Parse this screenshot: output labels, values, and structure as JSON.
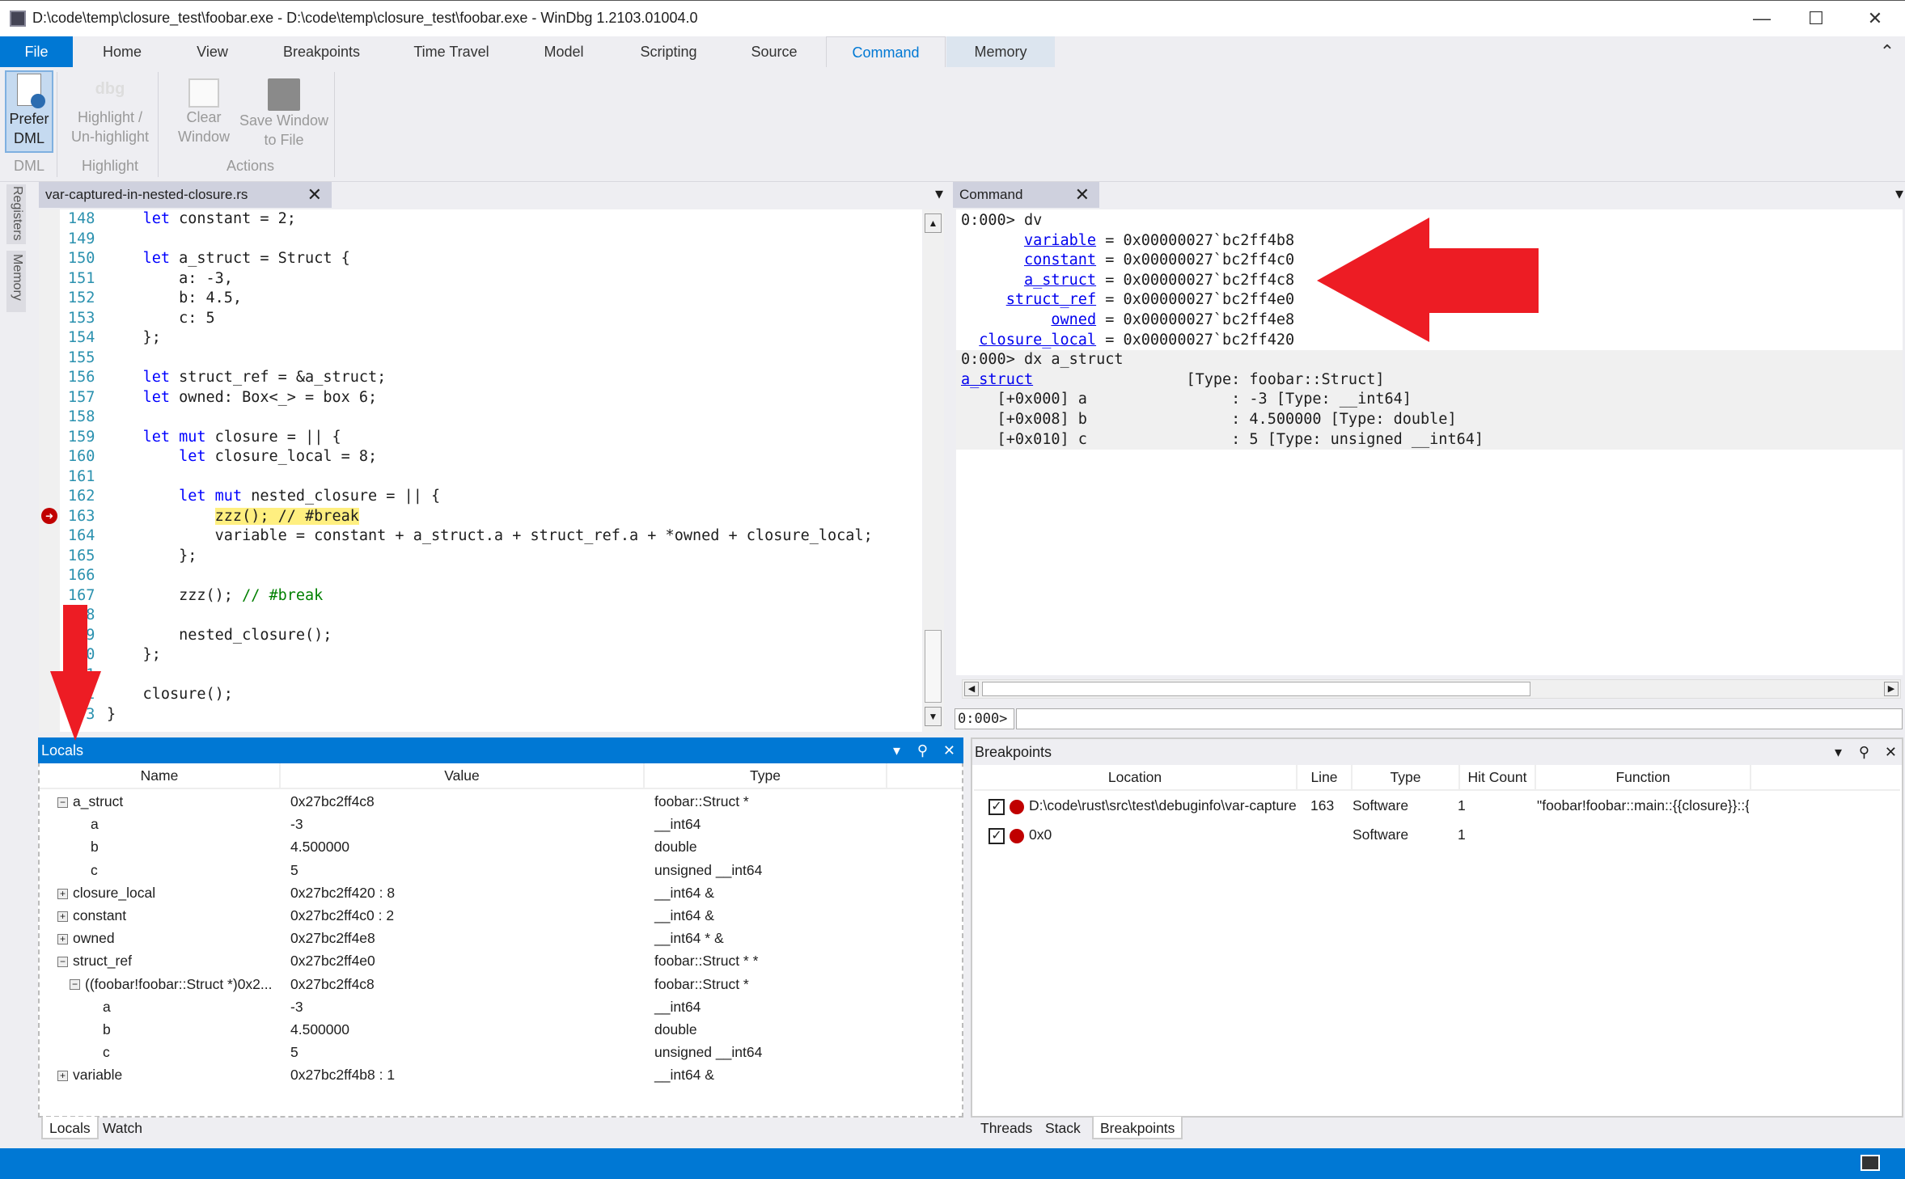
{
  "window": {
    "title": "D:\\code\\temp\\closure_test\\foobar.exe - D:\\code\\temp\\closure_test\\foobar.exe  - WinDbg 1.2103.01004.0",
    "minimize": "—",
    "maximize": "☐",
    "close": "✕"
  },
  "ribbon": {
    "file": "File",
    "tabs": [
      "Home",
      "View",
      "Breakpoints",
      "Time Travel",
      "Model",
      "Scripting",
      "Source",
      "Command",
      "Memory"
    ],
    "active_tab": "Command",
    "collapse": "⌃",
    "buttons": {
      "prefer_dml": [
        "Prefer",
        "DML"
      ],
      "highlight": [
        "Highlight /",
        "Un-highlight"
      ],
      "clear": [
        "Clear",
        "Window"
      ],
      "save": [
        "Save Window",
        "to File"
      ],
      "dbg_icon": "dbg"
    },
    "groups": [
      "DML",
      "Highlight",
      "Actions"
    ]
  },
  "side_tabs": [
    "Registers",
    "Memory"
  ],
  "source": {
    "tab": "var-captured-in-nested-closure.rs",
    "close": "✕",
    "menu": "▾",
    "current_line": 163,
    "lines": [
      {
        "n": "148",
        "t": [
          [
            "    ",
            ""
          ],
          [
            "let",
            "kw"
          ],
          [
            " constant = 2;",
            ""
          ]
        ]
      },
      {
        "n": "149",
        "t": []
      },
      {
        "n": "150",
        "t": [
          [
            "    ",
            ""
          ],
          [
            "let",
            "kw"
          ],
          [
            " a_struct = Struct {",
            ""
          ]
        ]
      },
      {
        "n": "151",
        "t": [
          [
            "        a: -3,",
            ""
          ]
        ]
      },
      {
        "n": "152",
        "t": [
          [
            "        b: 4.5,",
            ""
          ]
        ]
      },
      {
        "n": "153",
        "t": [
          [
            "        c: 5",
            ""
          ]
        ]
      },
      {
        "n": "154",
        "t": [
          [
            "    };",
            ""
          ]
        ]
      },
      {
        "n": "155",
        "t": []
      },
      {
        "n": "156",
        "t": [
          [
            "    ",
            ""
          ],
          [
            "let",
            "kw"
          ],
          [
            " struct_ref = &a_struct;",
            ""
          ]
        ]
      },
      {
        "n": "157",
        "t": [
          [
            "    ",
            ""
          ],
          [
            "let",
            "kw"
          ],
          [
            " owned: Box<_> = box 6;",
            ""
          ]
        ]
      },
      {
        "n": "158",
        "t": []
      },
      {
        "n": "159",
        "t": [
          [
            "    ",
            ""
          ],
          [
            "let",
            "kw"
          ],
          [
            " ",
            ""
          ],
          [
            "mut",
            "kw"
          ],
          [
            " closure = || {",
            ""
          ]
        ]
      },
      {
        "n": "160",
        "t": [
          [
            "        ",
            ""
          ],
          [
            "let",
            "kw"
          ],
          [
            " closure_local = 8;",
            ""
          ]
        ]
      },
      {
        "n": "161",
        "t": []
      },
      {
        "n": "162",
        "t": [
          [
            "        ",
            ""
          ],
          [
            "let",
            "kw"
          ],
          [
            " ",
            ""
          ],
          [
            "mut",
            "kw"
          ],
          [
            " nested_closure = || {",
            ""
          ]
        ]
      },
      {
        "n": "163",
        "t": [
          [
            "            ",
            ""
          ],
          [
            "zzz(); // #break",
            "hl"
          ]
        ]
      },
      {
        "n": "164",
        "t": [
          [
            "            variable = constant + a_struct.a + struct_ref.a + *owned + closure_local;",
            ""
          ]
        ]
      },
      {
        "n": "165",
        "t": [
          [
            "        };",
            ""
          ]
        ]
      },
      {
        "n": "166",
        "t": []
      },
      {
        "n": "167",
        "t": [
          [
            "        zzz(); ",
            ""
          ],
          [
            "// #break",
            "cm"
          ]
        ]
      },
      {
        "n": "168",
        "t": []
      },
      {
        "n": "169",
        "t": [
          [
            "        nested_closure();",
            ""
          ]
        ]
      },
      {
        "n": "170",
        "t": [
          [
            "    };",
            ""
          ]
        ]
      },
      {
        "n": "171",
        "t": []
      },
      {
        "n": "172",
        "t": [
          [
            "    closure();",
            ""
          ]
        ]
      },
      {
        "n": "173",
        "t": [
          [
            "}",
            ""
          ]
        ]
      }
    ]
  },
  "command": {
    "tab": "Command",
    "close": "✕",
    "menu": "▾",
    "prompt": "0:000>",
    "lines": [
      {
        "t": [
          [
            "0:000> dv",
            ""
          ]
        ]
      },
      {
        "t": [
          [
            "       ",
            ""
          ],
          [
            "variable",
            "lnk"
          ],
          [
            " = 0x00000027`bc2ff4b8",
            ""
          ]
        ]
      },
      {
        "t": [
          [
            "       ",
            ""
          ],
          [
            "constant",
            "lnk"
          ],
          [
            " = 0x00000027`bc2ff4c0",
            ""
          ]
        ]
      },
      {
        "t": [
          [
            "       ",
            ""
          ],
          [
            "a_struct",
            "lnk"
          ],
          [
            " = 0x00000027`bc2ff4c8",
            ""
          ]
        ]
      },
      {
        "t": [
          [
            "     ",
            ""
          ],
          [
            "struct_ref",
            "lnk"
          ],
          [
            " = 0x00000027`bc2ff4e0",
            ""
          ]
        ]
      },
      {
        "t": [
          [
            "          ",
            ""
          ],
          [
            "owned",
            "lnk"
          ],
          [
            " = 0x00000027`bc2ff4e8",
            ""
          ]
        ]
      },
      {
        "t": [
          [
            "  ",
            ""
          ],
          [
            "closure_local",
            "lnk"
          ],
          [
            " = 0x00000027`bc2ff420",
            ""
          ]
        ]
      },
      {
        "t": [
          [
            "0:000> dx a_struct",
            ""
          ]
        ],
        "bg": true
      },
      {
        "t": [
          [
            "a_struct",
            "lnk"
          ],
          [
            "                 [Type: foobar::Struct]",
            ""
          ]
        ],
        "bg": true
      },
      {
        "t": [
          [
            "    [+0x000] a                : -3 [Type: __int64]",
            ""
          ]
        ],
        "bg": true
      },
      {
        "t": [
          [
            "    [+0x008] b                : 4.500000 [Type: double]",
            ""
          ]
        ],
        "bg": true
      },
      {
        "t": [
          [
            "    [+0x010] c                : 5 [Type: unsigned __int64]",
            ""
          ]
        ],
        "bg": true
      }
    ]
  },
  "locals": {
    "title": "Locals",
    "columns": [
      "Name",
      "Value",
      "Type"
    ],
    "rows": [
      {
        "name": "a_struct",
        "value": "0x27bc2ff4c8",
        "type": "foobar::Struct *",
        "exp": "−",
        "lvl": 0
      },
      {
        "name": "a",
        "value": "-3",
        "type": "__int64",
        "exp": "",
        "lvl": 1
      },
      {
        "name": "b",
        "value": "4.500000",
        "type": "double",
        "exp": "",
        "lvl": 1
      },
      {
        "name": "c",
        "value": "5",
        "type": "unsigned __int64",
        "exp": "",
        "lvl": 1
      },
      {
        "name": "closure_local",
        "value": "0x27bc2ff420 : 8",
        "type": "__int64 &",
        "exp": "+",
        "lvl": 0
      },
      {
        "name": "constant",
        "value": "0x27bc2ff4c0 : 2",
        "type": "__int64 &",
        "exp": "+",
        "lvl": 0
      },
      {
        "name": "owned",
        "value": "0x27bc2ff4e8",
        "type": "__int64 * &",
        "exp": "+",
        "lvl": 0
      },
      {
        "name": "struct_ref",
        "value": "0x27bc2ff4e0",
        "type": "foobar::Struct * *",
        "exp": "−",
        "lvl": 0
      },
      {
        "name": "((foobar!foobar::Struct *)0x2...",
        "value": "0x27bc2ff4c8",
        "type": "foobar::Struct *",
        "exp": "−",
        "lvl": 1
      },
      {
        "name": "a",
        "value": "-3",
        "type": "__int64",
        "exp": "",
        "lvl": 2
      },
      {
        "name": "b",
        "value": "4.500000",
        "type": "double",
        "exp": "",
        "lvl": 2
      },
      {
        "name": "c",
        "value": "5",
        "type": "unsigned __int64",
        "exp": "",
        "lvl": 2
      },
      {
        "name": "variable",
        "value": "0x27bc2ff4b8 : 1",
        "type": "__int64 &",
        "exp": "+",
        "lvl": 0
      }
    ],
    "bottom_tabs": [
      "Locals",
      "Watch"
    ]
  },
  "breakpoints": {
    "title": "Breakpoints",
    "columns": [
      "Location",
      "Line",
      "Type",
      "Hit Count",
      "Function"
    ],
    "rows": [
      {
        "enabled": true,
        "location": "D:\\code\\rust\\src\\test\\debuginfo\\var-captured-in-nested-closure.rs",
        "line": "163",
        "type": "Software",
        "hits": "1",
        "function": "\"foobar!foobar::main::{{closure}}::{{closure}}\""
      },
      {
        "enabled": true,
        "location": "0x0",
        "line": "",
        "type": "Software",
        "hits": "1",
        "function": ""
      }
    ],
    "bottom_tabs": [
      "Threads",
      "Stack",
      "Breakpoints"
    ]
  },
  "pane_controls": {
    "menu": "▾",
    "pin": "⚲",
    "close": "✕"
  },
  "colors": {
    "accent": "#0078d4",
    "annotation_arrow": "#ed1c24",
    "breakpoint": "#c00000"
  }
}
